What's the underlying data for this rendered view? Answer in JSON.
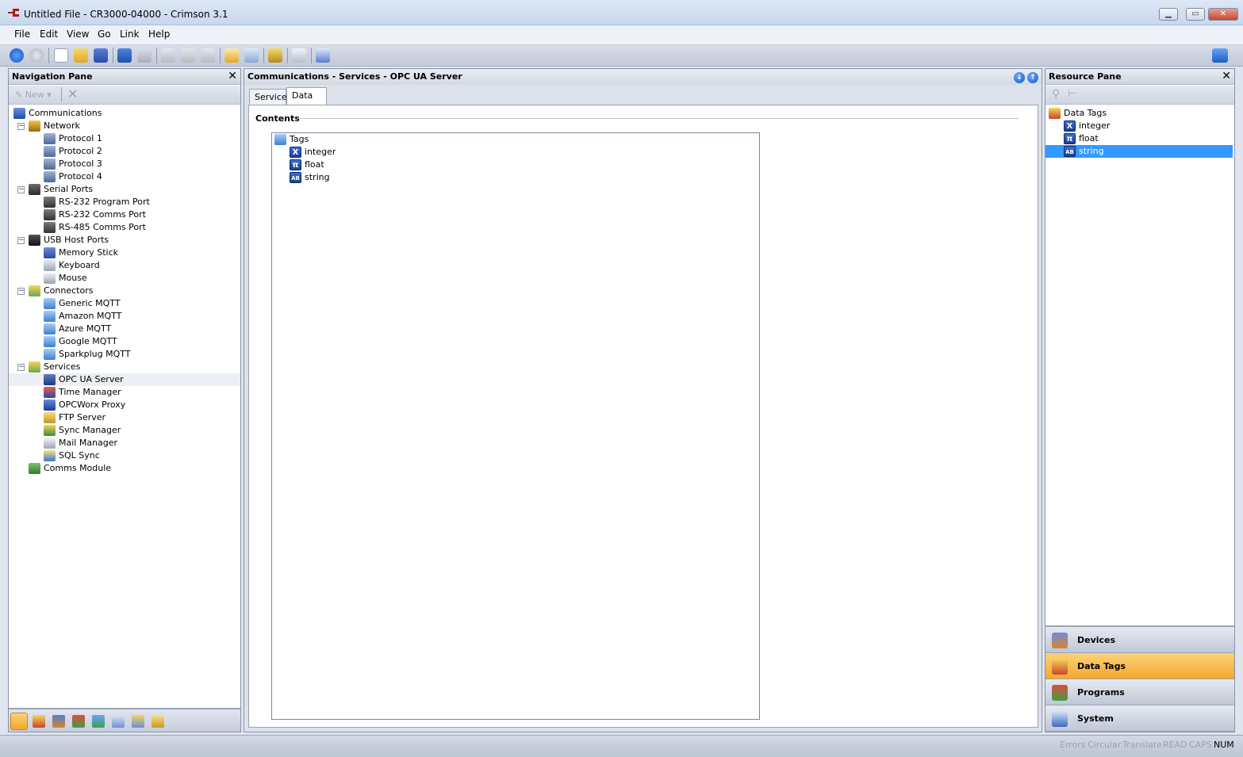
{
  "window": {
    "title": "Untitled File - CR3000-04000 - Crimson 3.1",
    "controls": [
      "minimize",
      "maximize",
      "close"
    ]
  },
  "menu": [
    "File",
    "Edit",
    "View",
    "Go",
    "Link",
    "Help"
  ],
  "toolbar": {
    "icons": [
      "back-icon",
      "forward-icon",
      "new-file-icon",
      "open-folder-icon",
      "save-icon",
      "undo-icon",
      "redo-icon",
      "cut-icon",
      "copy-icon",
      "paste-icon",
      "find-all-icon",
      "find-icon",
      "link-icon",
      "comment-icon",
      "send-icon",
      "help-icon"
    ]
  },
  "nav_pane": {
    "title": "Navigation Pane",
    "new_label": "New",
    "tree": [
      {
        "label": "Communications",
        "level": 0,
        "icon": "computer-icon"
      },
      {
        "label": "Network",
        "level": 1,
        "icon": "network-icon",
        "expander": "−"
      },
      {
        "label": "Protocol 1",
        "level": 2,
        "icon": "protocol-icon"
      },
      {
        "label": "Protocol 2",
        "level": 2,
        "icon": "protocol-icon"
      },
      {
        "label": "Protocol 3",
        "level": 2,
        "icon": "protocol-icon"
      },
      {
        "label": "Protocol 4",
        "level": 2,
        "icon": "protocol-icon"
      },
      {
        "label": "Serial Ports",
        "level": 1,
        "icon": "serial-icon",
        "expander": "−"
      },
      {
        "label": "RS-232 Program Port",
        "level": 2,
        "icon": "port-icon"
      },
      {
        "label": "RS-232 Comms Port",
        "level": 2,
        "icon": "port-icon"
      },
      {
        "label": "RS-485 Comms Port",
        "level": 2,
        "icon": "port-icon"
      },
      {
        "label": "USB Host Ports",
        "level": 1,
        "icon": "usb-icon",
        "expander": "−"
      },
      {
        "label": "Memory Stick",
        "level": 2,
        "icon": "memory-stick-icon"
      },
      {
        "label": "Keyboard",
        "level": 2,
        "icon": "keyboard-icon"
      },
      {
        "label": "Mouse",
        "level": 2,
        "icon": "mouse-icon"
      },
      {
        "label": "Connectors",
        "level": 1,
        "icon": "connectors-icon",
        "expander": "−"
      },
      {
        "label": "Generic MQTT",
        "level": 2,
        "icon": "cloud-icon"
      },
      {
        "label": "Amazon MQTT",
        "level": 2,
        "icon": "cloud-icon"
      },
      {
        "label": "Azure MQTT",
        "level": 2,
        "icon": "cloud-icon"
      },
      {
        "label": "Google MQTT",
        "level": 2,
        "icon": "cloud-icon"
      },
      {
        "label": "Sparkplug MQTT",
        "level": 2,
        "icon": "cloud-icon"
      },
      {
        "label": "Services",
        "level": 1,
        "icon": "services-icon",
        "expander": "−"
      },
      {
        "label": "OPC UA Server",
        "level": 2,
        "icon": "opc-ua-icon",
        "selected": true
      },
      {
        "label": "Time Manager",
        "level": 2,
        "icon": "clock-icon"
      },
      {
        "label": "OPCWorx Proxy",
        "level": 2,
        "icon": "proxy-icon"
      },
      {
        "label": "FTP Server",
        "level": 2,
        "icon": "ftp-icon"
      },
      {
        "label": "Sync Manager",
        "level": 2,
        "icon": "sync-icon"
      },
      {
        "label": "Mail Manager",
        "level": 2,
        "icon": "mail-icon"
      },
      {
        "label": "SQL Sync",
        "level": 2,
        "icon": "sql-icon"
      },
      {
        "label": "Comms Module",
        "level": 1,
        "icon": "module-icon"
      }
    ],
    "bottom_icons": [
      "communications-view-icon",
      "data-tags-view-icon",
      "display-pages-view-icon",
      "programs-view-icon",
      "web-server-view-icon",
      "data-logger-view-icon",
      "security-view-icon",
      "sql-view-icon"
    ]
  },
  "main": {
    "header": "Communications - Services - OPC UA Server",
    "tabs": [
      {
        "label": "Service"
      },
      {
        "label": "Data",
        "active": true
      }
    ],
    "contents_title": "Contents",
    "contents": [
      {
        "label": "Tags",
        "level": 0,
        "icon": "tags-folder-icon"
      },
      {
        "label": "integer",
        "level": 1,
        "icon": "integer-tag-icon",
        "glyph": "X"
      },
      {
        "label": "float",
        "level": 1,
        "icon": "float-tag-icon",
        "glyph": "π"
      },
      {
        "label": "string",
        "level": 1,
        "icon": "string-tag-icon",
        "glyph": "AB"
      }
    ]
  },
  "res_pane": {
    "title": "Resource Pane",
    "tree": [
      {
        "label": "Data Tags",
        "level": 0,
        "icon": "data-tags-icon"
      },
      {
        "label": "integer",
        "level": 1,
        "icon": "integer-tag-icon",
        "glyph": "X"
      },
      {
        "label": "float",
        "level": 1,
        "icon": "float-tag-icon",
        "glyph": "π"
      },
      {
        "label": "string",
        "level": 1,
        "icon": "string-tag-icon",
        "glyph": "AB",
        "selected": true
      }
    ],
    "categories": [
      {
        "label": "Devices",
        "icon": "devices-icon"
      },
      {
        "label": "Data Tags",
        "icon": "data-tags-icon",
        "active": true
      },
      {
        "label": "Programs",
        "icon": "programs-icon"
      },
      {
        "label": "System",
        "icon": "system-icon"
      }
    ]
  },
  "status": {
    "items": [
      {
        "label": "Errors",
        "on": false
      },
      {
        "label": "Circular",
        "on": false
      },
      {
        "label": "Translate",
        "on": false
      },
      {
        "label": "READ",
        "on": false
      },
      {
        "label": "CAPS",
        "on": false
      },
      {
        "label": "NUM",
        "on": true
      }
    ]
  },
  "colors": {
    "selection": "#3399ff",
    "accent_active": "#f4a72b",
    "pane_border": "#8994a9"
  }
}
